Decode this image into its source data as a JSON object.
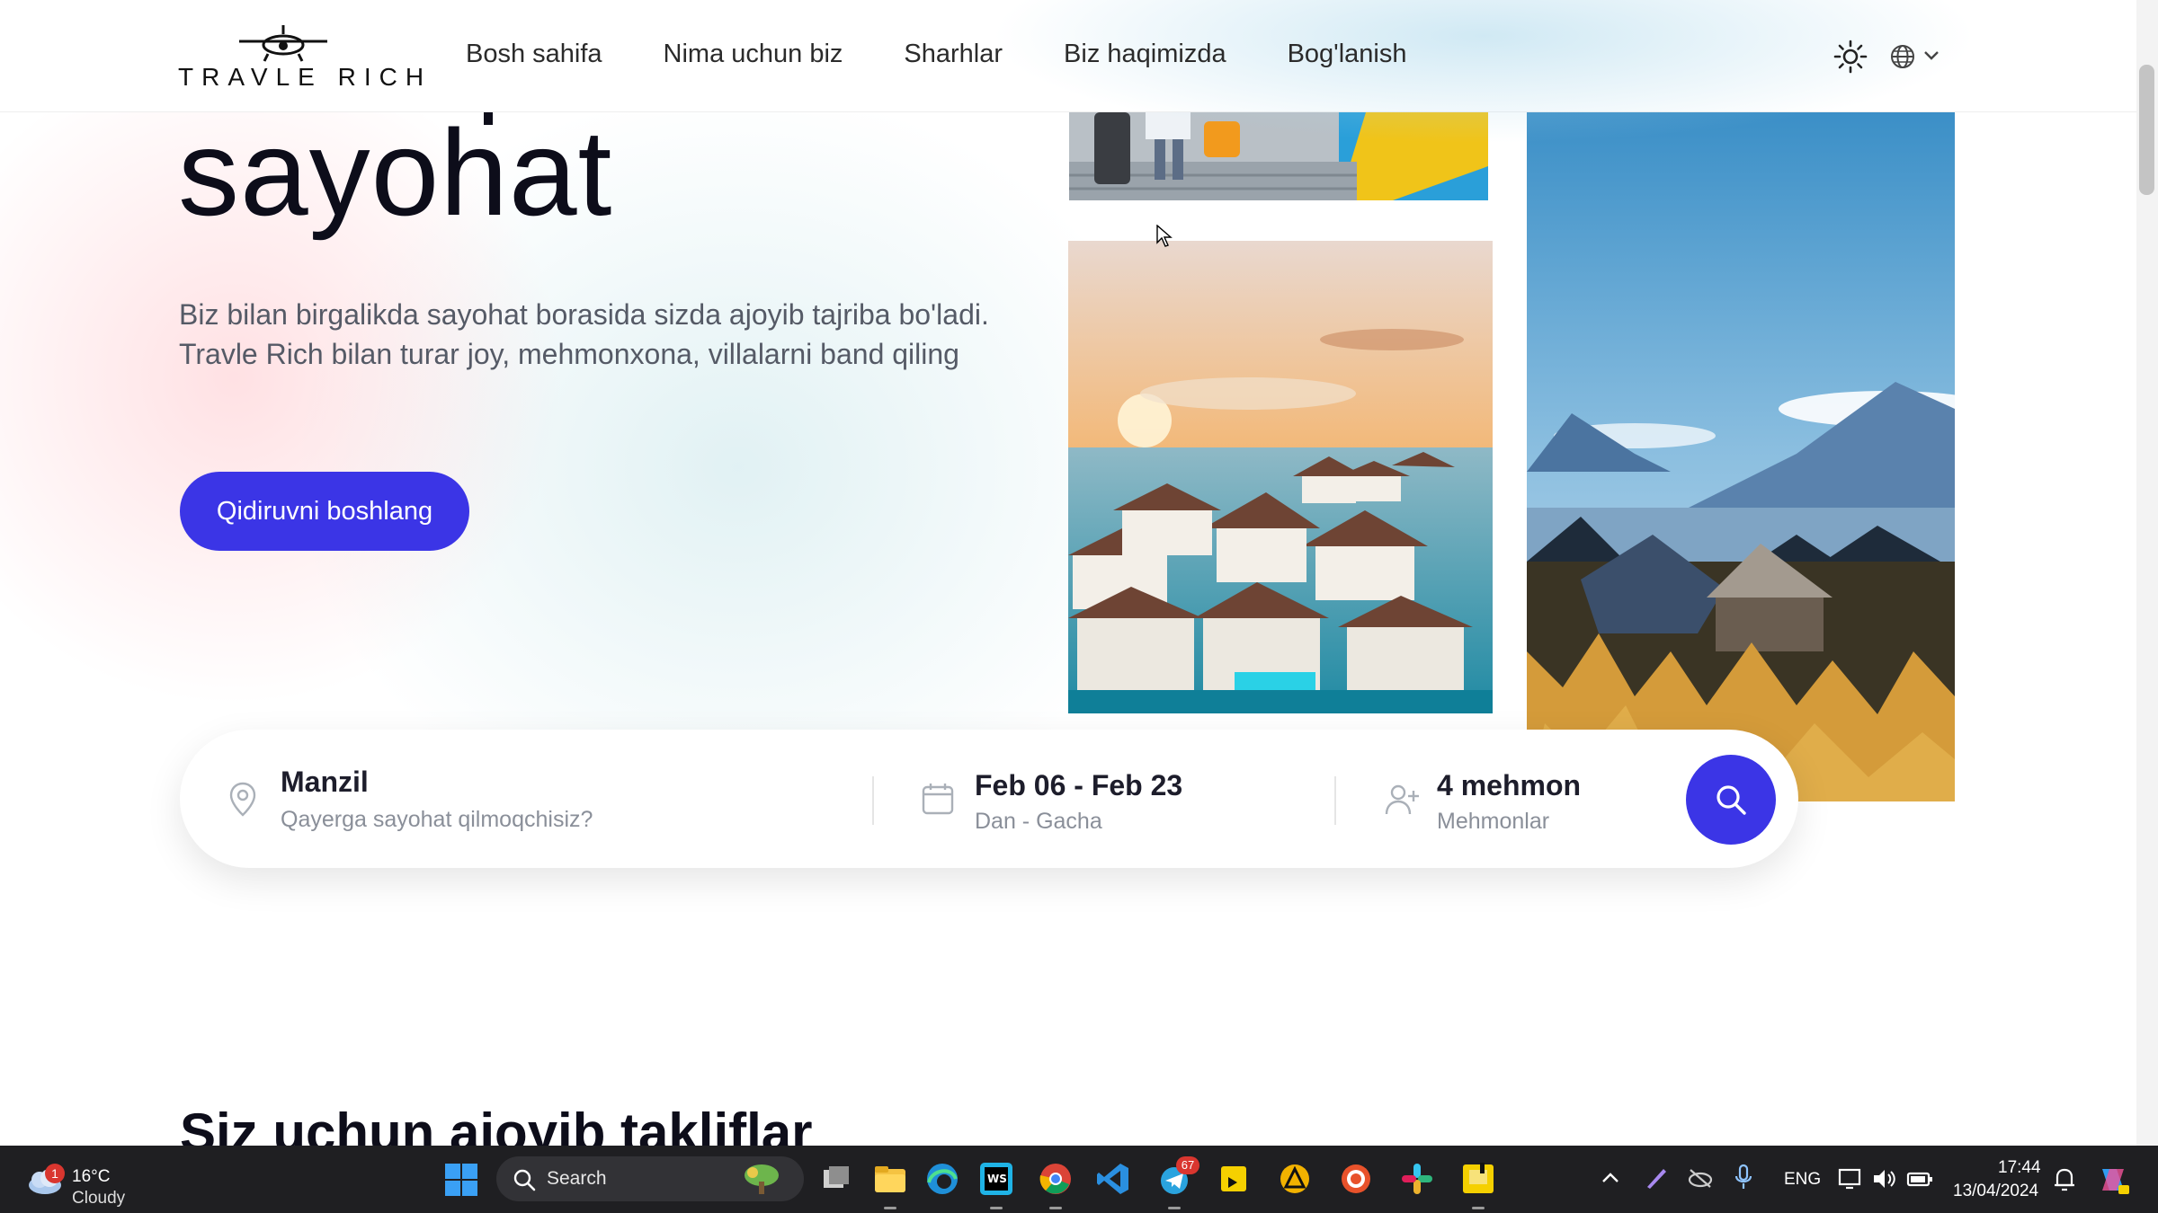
{
  "header": {
    "logo_text": "TRAVLE RICH",
    "nav": [
      "Bosh sahifa",
      "Nima uchun biz",
      "Sharhlar",
      "Biz haqimizda",
      "Bog'lanish"
    ]
  },
  "hero": {
    "title": "sayohat",
    "description": "Biz bilan birgalikda sayohat borasida sizda ajoyib tajriba bo'ladi. Travle Rich bilan turar joy, mehmonxona, villalarni band qiling",
    "cta": "Qidiruvni boshlang"
  },
  "search": {
    "destination_label": "Manzil",
    "destination_placeholder": "Qayerga sayohat qilmoqchisiz?",
    "dates_label": "Feb 06 - Feb 23",
    "dates_sub": "Dan - Gacha",
    "guests_label": "4 mehmon",
    "guests_sub": "Mehmonlar"
  },
  "section": {
    "title": "Siz uchun ajoyib takliflar"
  },
  "colors": {
    "accent": "#3b35e6",
    "text_dark": "#0d0d1a",
    "muted": "#8a8f99"
  },
  "taskbar": {
    "weather_temp": "16°C",
    "weather_condition": "Cloudy",
    "weather_badge": "1",
    "search_text": "Search",
    "telegram_badge": "67",
    "language": "ENG",
    "time": "17:44",
    "date": "13/04/2024"
  }
}
